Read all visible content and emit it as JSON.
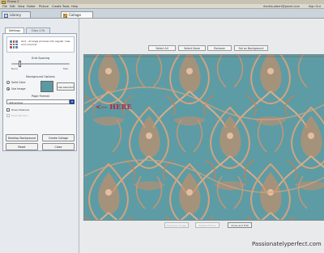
{
  "window": {
    "title": "Picasa 3"
  },
  "menu": {
    "items": [
      "File",
      "Edit",
      "View",
      "Folder",
      "Picture",
      "Create",
      "Tools",
      "Help"
    ],
    "user": "rhedlia.albert@gmail.com",
    "sign_out": "Sign Out"
  },
  "tabs": {
    "library": "Library",
    "collage": "Collage"
  },
  "left_panel": {
    "tabs": {
      "settings": "Settings",
      "clips": "Clips (19)"
    },
    "layout_card": {
      "description": "Grid - Arrange pictures into regular rows and columns"
    },
    "grid_spacing": {
      "label": "Grid Spacing",
      "min_label": "None",
      "max_label": "Max",
      "value": 0.15
    },
    "background": {
      "label": "Background Options",
      "solid_color": "Solid Color",
      "use_image": "Use Image",
      "selected": "use_image",
      "use_selected_btn": "Use selected",
      "swatch_color": "#5a9aa3"
    },
    "page_format": {
      "label": "Page Format",
      "value": "4x6 picture"
    },
    "drop_shadows": "Draw Shadows",
    "draw_borders": "Draw Borders",
    "buttons": {
      "desktop_background": "Desktop Background",
      "create_collage": "Create Collage",
      "reset": "Reset",
      "close": "Close"
    }
  },
  "toolbar": {
    "select_all": "Select All",
    "select_none": "Select None",
    "remove": "Remove",
    "set_as_background": "Set as Background"
  },
  "canvas": {
    "annotation": "<-- HERE",
    "background_color": "#5d9ca5",
    "pattern_color": "#c58e6a"
  },
  "bottom_bar": {
    "button_1": "Recenter Image",
    "button_2": "Rotate Picture",
    "close_and_edit": "Close and Edit"
  },
  "watermark": "Passionatelyperfect.com"
}
